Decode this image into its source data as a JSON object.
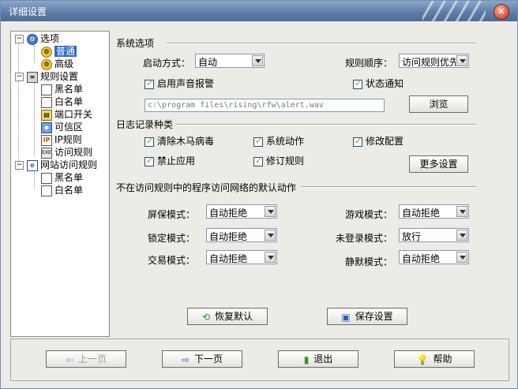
{
  "window": {
    "title": "详细设置"
  },
  "tree": {
    "options": "选项",
    "general": "普通",
    "advanced": "高级",
    "rules": "规则设置",
    "blacklist": "黑名单",
    "whitelist": "白名单",
    "port_switch": "端口开关",
    "trusted_zone": "可信区",
    "ip_rules": "IP规则",
    "access_rules": "访问规则",
    "web_access_rules": "网站访问规则",
    "web_blacklist": "黑名单",
    "web_whitelist": "白名单",
    "expand_symbol": "−"
  },
  "system_options": {
    "header": "系统选项",
    "startup_label": "启动方式：",
    "startup_value": "自动",
    "rule_order_label": "规则顺序：",
    "rule_order_value": "访问规则优先",
    "sound_alarm": "启用声音报警",
    "status_notify": "状态通知",
    "sound_path": "c:\\program files\\rising\\rfw\\alert.wav",
    "browse": "浏览"
  },
  "log_types": {
    "header": "日志记录种类",
    "clear_trojan": "清除木马病毒",
    "system_action": "系统动作",
    "modify_config": "修改配置",
    "ban_app": "禁止应用",
    "revise_rule": "修订规则",
    "more_settings": "更多设置"
  },
  "default_action": {
    "header": "不在访问规则中的程序访问网络的默认动作",
    "screensaver_label": "屏保模式：",
    "screensaver_value": "自动拒绝",
    "lock_label": "锁定模式：",
    "lock_value": "自动拒绝",
    "trade_label": "交易模式：",
    "trade_value": "自动拒绝",
    "game_label": "游戏模式：",
    "game_value": "自动拒绝",
    "notlogin_label": "未登录模式：",
    "notlogin_value": "放行",
    "silent_label": "静默模式：",
    "silent_value": "自动拒绝"
  },
  "actions": {
    "restore_default": "恢复默认",
    "save_settings": "保存设置"
  },
  "footer": {
    "prev": "上一页",
    "next": "下一页",
    "exit": "退出",
    "help": "帮助"
  },
  "colors": {
    "title_bar": "#5c7aa5",
    "selection": "#3169c6",
    "check": "#d47a10"
  }
}
